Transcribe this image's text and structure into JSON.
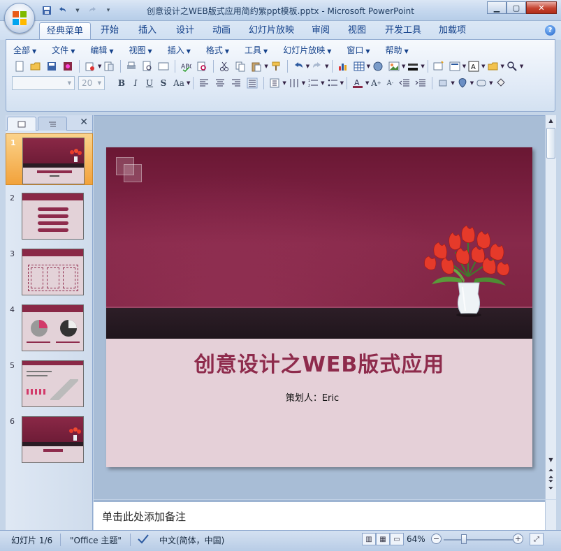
{
  "window": {
    "title": "创意设计之WEB版式应用简约紫ppt模板.pptx - Microsoft PowerPoint",
    "controls": [
      "minimize",
      "maximize",
      "close"
    ]
  },
  "tabs": [
    {
      "label": "经典菜单",
      "active": true
    },
    {
      "label": "开始"
    },
    {
      "label": "插入"
    },
    {
      "label": "设计"
    },
    {
      "label": "动画"
    },
    {
      "label": "幻灯片放映"
    },
    {
      "label": "审阅"
    },
    {
      "label": "视图"
    },
    {
      "label": "开发工具"
    },
    {
      "label": "加载项"
    }
  ],
  "menubar": [
    "全部",
    "文件",
    "编辑",
    "视图",
    "插入",
    "格式",
    "工具",
    "幻灯片放映",
    "窗口",
    "帮助"
  ],
  "format": {
    "font_name": "",
    "font_size": "20"
  },
  "slides": [
    {
      "number": "1",
      "selected": true
    },
    {
      "number": "2"
    },
    {
      "number": "3"
    },
    {
      "number": "4"
    },
    {
      "number": "5"
    },
    {
      "number": "6"
    }
  ],
  "slide": {
    "title": "创意设计之WEB版式应用",
    "subtitle": "策划人：Eric"
  },
  "notes": {
    "placeholder": "单击此处添加备注"
  },
  "status": {
    "slide_info": "幻灯片 1/6",
    "theme": "\"Office 主题\"",
    "language": "中文(简体，中国)",
    "zoom": "64%"
  },
  "colors": {
    "slide_primary": "#7c2142",
    "slide_band": "#2a1c24",
    "slide_bg": "#e5d0d8",
    "title_color": "#8e2b4c",
    "selection_orange": "#f2a23b"
  }
}
